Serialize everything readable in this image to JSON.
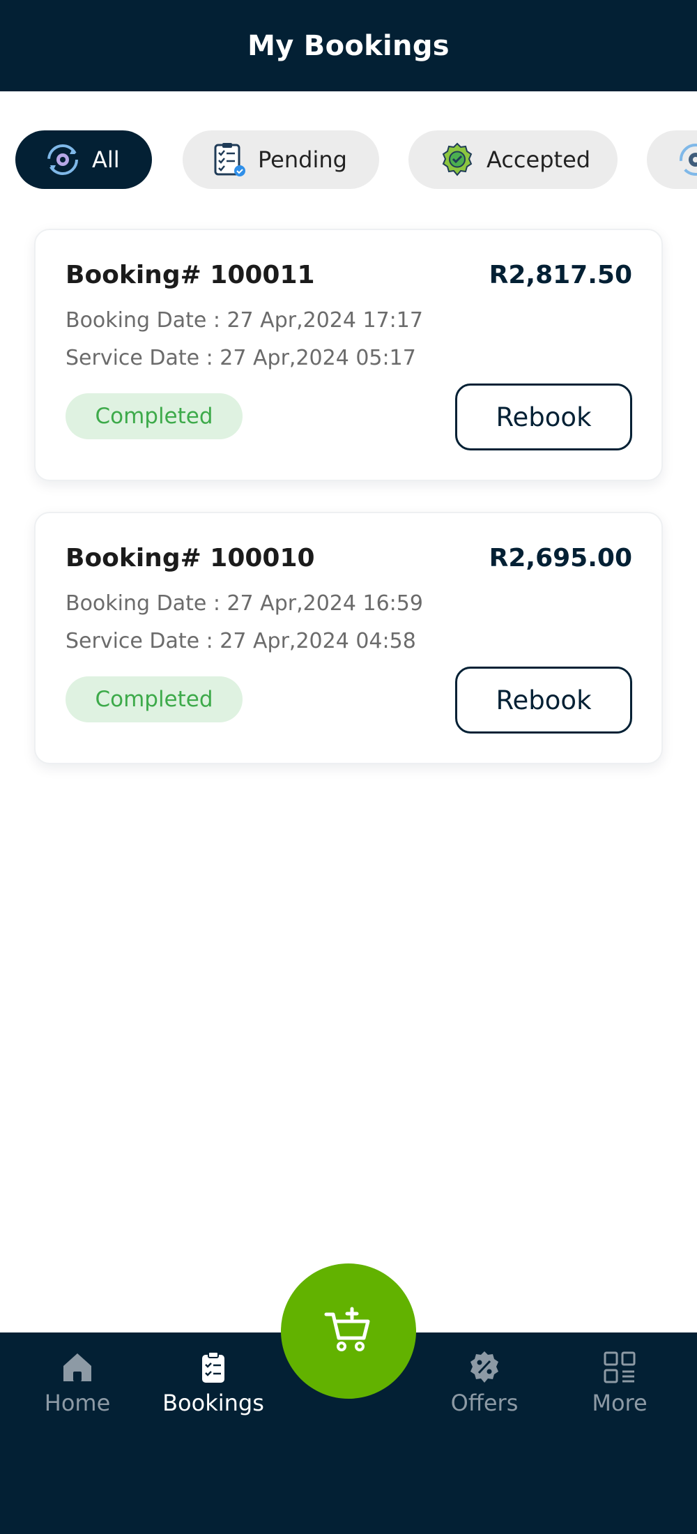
{
  "header": {
    "title": "My Bookings"
  },
  "filters": [
    {
      "label": "All",
      "icon": "all-refresh-icon",
      "active": true
    },
    {
      "label": "Pending",
      "icon": "clipboard-check-icon",
      "active": false
    },
    {
      "label": "Accepted",
      "icon": "badge-check-icon",
      "active": false
    },
    {
      "label": "",
      "icon": "gear-refresh-icon",
      "active": false
    }
  ],
  "bookings": [
    {
      "id_label": "Booking# 100011",
      "amount": "R2,817.50",
      "booking_date": "Booking Date : 27 Apr,2024 17:17",
      "service_date": "Service Date : 27 Apr,2024 05:17",
      "status": "Completed",
      "action_label": "Rebook"
    },
    {
      "id_label": "Booking# 100010",
      "amount": "R2,695.00",
      "booking_date": "Booking Date : 27 Apr,2024 16:59",
      "service_date": "Service Date : 27 Apr,2024 04:58",
      "status": "Completed",
      "action_label": "Rebook"
    }
  ],
  "bottom_nav": {
    "items": [
      {
        "label": "Home",
        "icon": "home-icon",
        "active": false
      },
      {
        "label": "Bookings",
        "icon": "clipboard-list-icon",
        "active": true
      },
      {
        "label": "Offers",
        "icon": "percent-badge-icon",
        "active": false
      },
      {
        "label": "More",
        "icon": "grid-more-icon",
        "active": false
      }
    ],
    "fab_icon": "cart-add-icon"
  },
  "colors": {
    "header_bg": "#032034",
    "chip_active_bg": "#032034",
    "chip_inactive_bg": "#ececec",
    "status_completed_bg": "#dff2e1",
    "status_completed_text": "#3daa4a",
    "fab_bg": "#62b200",
    "nav_inactive": "#8d9aa5"
  }
}
